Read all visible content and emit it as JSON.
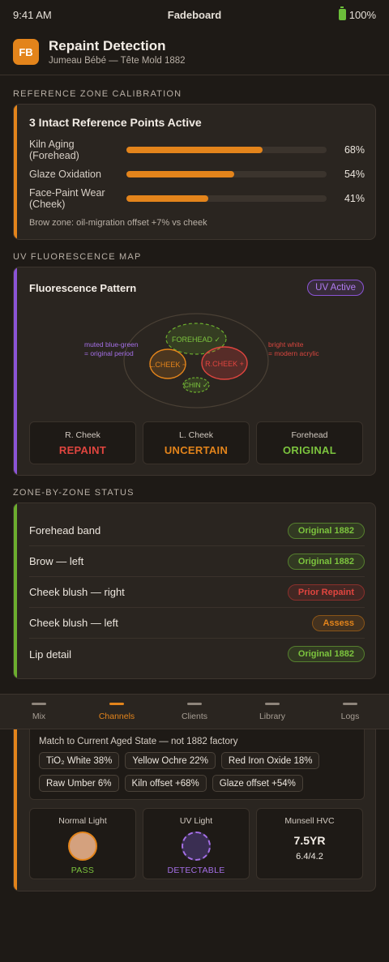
{
  "status_bar": {
    "time": "9:41 AM",
    "app_name": "Fadeboard",
    "battery": "100%"
  },
  "header": {
    "logo_text": "FB",
    "title": "Repaint Detection",
    "subtitle": "Jumeau Bébé — Tête Mold 1882"
  },
  "calibration": {
    "section_label": "REFERENCE ZONE CALIBRATION",
    "title": "3 Intact Reference Points Active",
    "rows": [
      {
        "label": "Kiln Aging (Forehead)",
        "value": 68,
        "value_label": "68%"
      },
      {
        "label": "Glaze Oxidation",
        "value": 54,
        "value_label": "54%"
      },
      {
        "label": "Face-Paint Wear (Cheek)",
        "value": 41,
        "value_label": "41%"
      }
    ],
    "note": "Brow zone: oil-migration offset +7% vs cheek",
    "accent_color": "#e3841b"
  },
  "uv_map": {
    "section_label": "UV FLUORESCENCE MAP",
    "title": "Fluorescence Pattern",
    "badge": "UV Active",
    "left_annotation_1": "muted blue-green",
    "left_annotation_2": "= original period",
    "right_annotation_1": "bright white",
    "right_annotation_2": "= modern acrylic",
    "zones": {
      "forehead": "FOREHEAD ✓",
      "l_cheek": "L.CHEEK ~",
      "r_cheek": "R.CHEEK +",
      "chin": "CHIN ✓"
    },
    "results": [
      {
        "name": "R. Cheek",
        "value": "REPAINT",
        "color": "#e0453f"
      },
      {
        "name": "L. Cheek",
        "value": "UNCERTAIN",
        "color": "#e3841b"
      },
      {
        "name": "Forehead",
        "value": "ORIGINAL",
        "color": "#7cc43e"
      }
    ],
    "accent_color": "#8b54d6"
  },
  "zones": {
    "section_label": "ZONE-BY-ZONE STATUS",
    "rows": [
      {
        "name": "Forehead band",
        "status": "Original 1882",
        "kind": "ok"
      },
      {
        "name": "Brow — left",
        "status": "Original 1882",
        "kind": "ok"
      },
      {
        "name": "Cheek blush — right",
        "status": "Prior Repaint",
        "kind": "bad"
      },
      {
        "name": "Cheek blush — left",
        "status": "Assess",
        "kind": "warn"
      },
      {
        "name": "Lip detail",
        "status": "Original 1882",
        "kind": "ok"
      }
    ],
    "accent_color": "#6cae2e"
  },
  "tabbar": {
    "tabs": [
      {
        "label": "Mix",
        "active": false
      },
      {
        "label": "Channels",
        "active": true
      },
      {
        "label": "Clients",
        "active": false
      },
      {
        "label": "Library",
        "active": false
      },
      {
        "label": "Logs",
        "active": false
      }
    ]
  },
  "mix": {
    "title": "Match to Current Aged State — not 1882 factory",
    "chips": [
      "TiO₂ White 38%",
      "Yellow Ochre 22%",
      "Red Iron Oxide 18%",
      "Raw Umber 6%",
      "Kiln offset +68%",
      "Glaze offset +54%"
    ],
    "normal_light": {
      "title": "Normal Light",
      "status": "PASS",
      "swatch_color": "#d4a17e"
    },
    "uv_light": {
      "title": "UV Light",
      "status": "DETECTABLE",
      "swatch_color": "#3a2e52"
    },
    "munsell": {
      "title": "Munsell HVC",
      "hue": "7.5YR",
      "value_chroma": "6.4/4.2"
    }
  }
}
